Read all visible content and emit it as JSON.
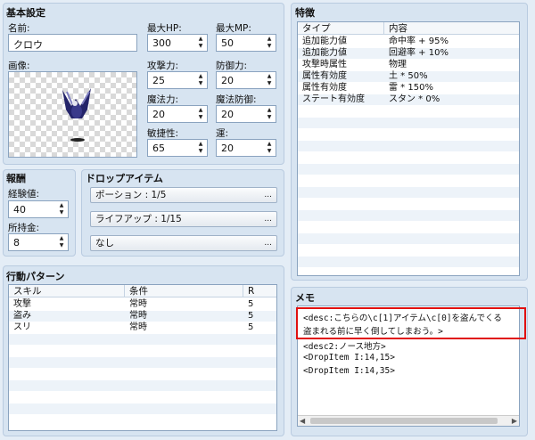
{
  "basic": {
    "title": "基本設定",
    "name_label": "名前:",
    "name_value": "クロウ",
    "image_label": "画像:",
    "max_hp_label": "最大HP:",
    "max_hp": "300",
    "max_mp_label": "最大MP:",
    "max_mp": "50",
    "atk_label": "攻撃力:",
    "atk": "25",
    "def_label": "防御力:",
    "def": "20",
    "mat_label": "魔法力:",
    "mat": "20",
    "mdf_label": "魔法防御:",
    "mdf": "20",
    "agi_label": "敏捷性:",
    "agi": "65",
    "luk_label": "運:",
    "luk": "20"
  },
  "reward": {
    "title": "報酬",
    "exp_label": "経験値:",
    "exp": "40",
    "gold_label": "所持金:",
    "gold": "8"
  },
  "drops": {
    "title": "ドロップアイテム",
    "items": [
      "ポーション : 1/5",
      "ライフアップ : 1/15",
      "なし"
    ],
    "more": "..."
  },
  "traits": {
    "title": "特徴",
    "col_type": "タイプ",
    "col_content": "内容",
    "rows": [
      {
        "type": "追加能力値",
        "content": "命中率 + 95%"
      },
      {
        "type": "追加能力値",
        "content": "回避率 + 10%"
      },
      {
        "type": "攻撃時属性",
        "content": "物理"
      },
      {
        "type": "属性有効度",
        "content": "土 * 50%"
      },
      {
        "type": "属性有効度",
        "content": "雷 * 150%"
      },
      {
        "type": "ステート有効度",
        "content": "スタン * 0%"
      }
    ]
  },
  "actions": {
    "title": "行動パターン",
    "col_skill": "スキル",
    "col_condition": "条件",
    "col_r": "R",
    "rows": [
      {
        "skill": "攻撃",
        "condition": "常時",
        "r": "5"
      },
      {
        "skill": "盗み",
        "condition": "常時",
        "r": "5"
      },
      {
        "skill": "スリ",
        "condition": "常時",
        "r": "5"
      }
    ]
  },
  "memo": {
    "title": "メモ",
    "line1": "<desc:こちらの\\c[1]アイテム\\c[0]を盗んでくる",
    "line2": "盗まれる前に早く倒してしまおう。>",
    "line3": "<desc2:ノース地方>",
    "line4": "<DropItem I:14,15>",
    "line5": "<DropItem I:14,35>"
  },
  "colors": {
    "panel_bg": "#d7e4f1",
    "highlight_border": "#e01010",
    "list_alt_row": "#edf3f9"
  }
}
